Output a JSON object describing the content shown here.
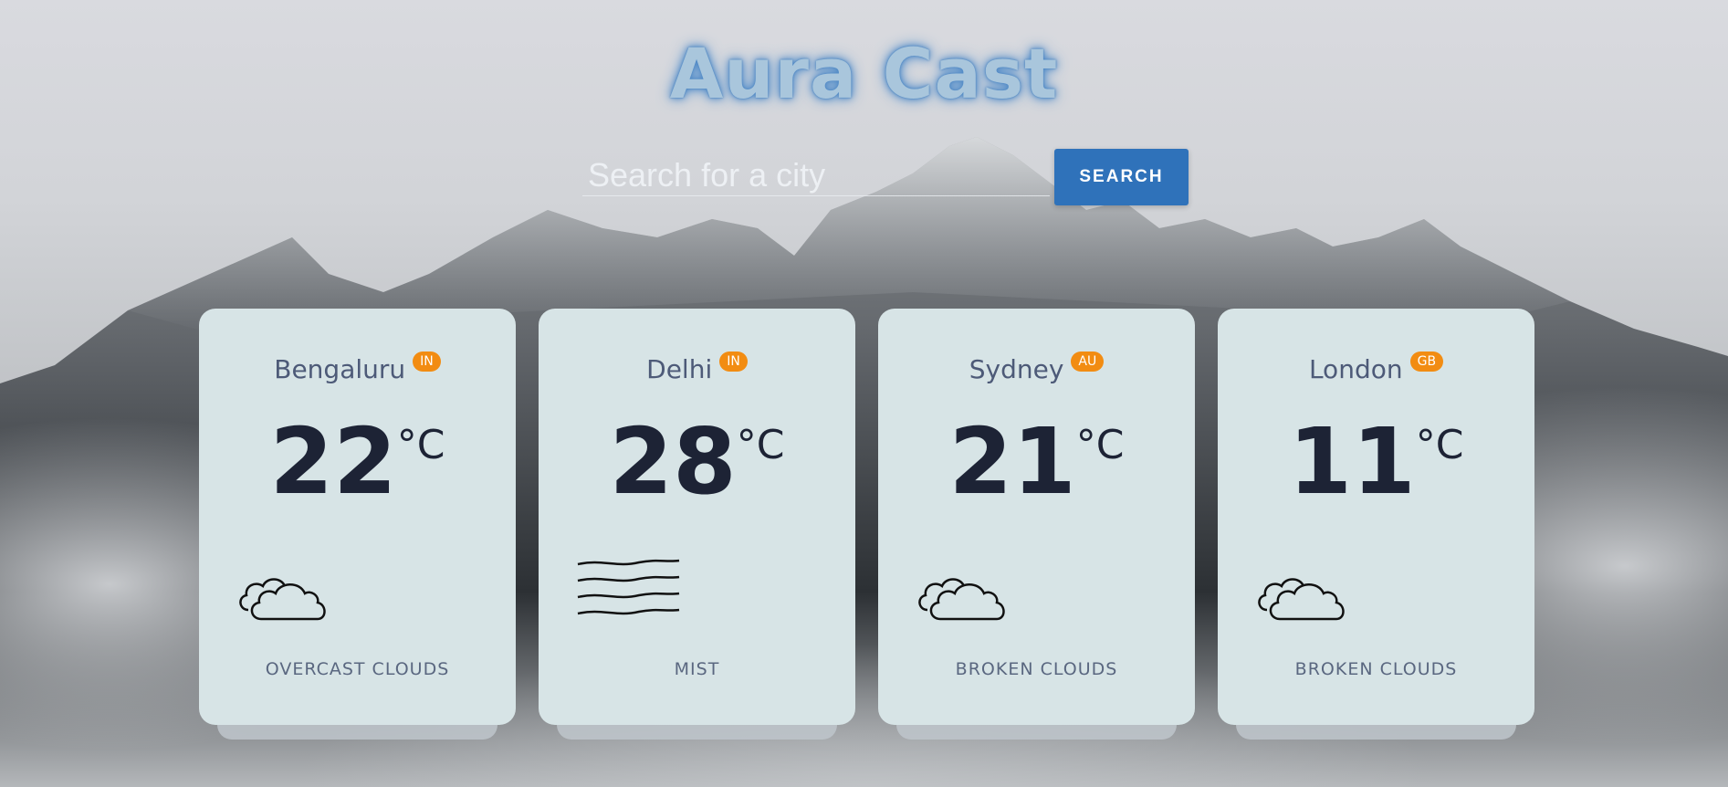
{
  "app": {
    "title": "Aura Cast"
  },
  "search": {
    "placeholder": "Search for a city",
    "value": "",
    "button_label": "SEARCH"
  },
  "colors": {
    "accent": "#2f72ba",
    "badge": "#f28c12",
    "card": "#d7e4e6",
    "title_glow": "#4b86c4"
  },
  "cards": [
    {
      "city": "Bengaluru",
      "country": "IN",
      "temp": "22",
      "unit": "°C",
      "description": "OVERCAST CLOUDS",
      "icon": "clouds-icon"
    },
    {
      "city": "Delhi",
      "country": "IN",
      "temp": "28",
      "unit": "°C",
      "description": "MIST",
      "icon": "mist-icon"
    },
    {
      "city": "Sydney",
      "country": "AU",
      "temp": "21",
      "unit": "°C",
      "description": "BROKEN CLOUDS",
      "icon": "clouds-icon"
    },
    {
      "city": "London",
      "country": "GB",
      "temp": "11",
      "unit": "°C",
      "description": "BROKEN CLOUDS",
      "icon": "clouds-icon"
    }
  ]
}
